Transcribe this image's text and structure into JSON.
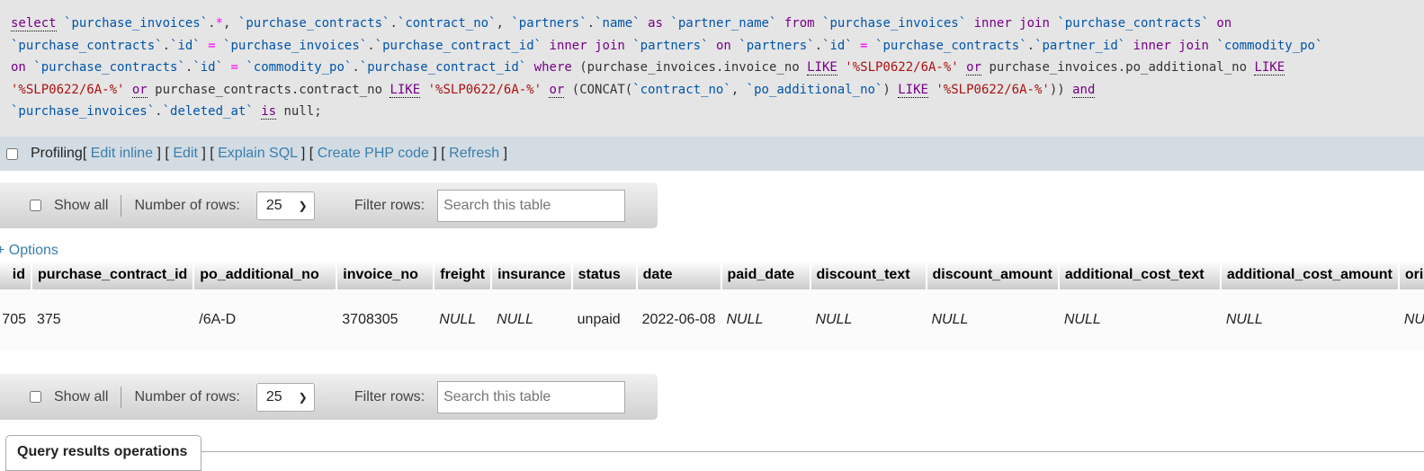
{
  "sql_lines": [
    [
      [
        "kwu",
        "select"
      ],
      [
        "pl",
        " "
      ],
      [
        "id",
        "`purchase_invoices`"
      ],
      [
        "pl",
        "."
      ],
      [
        "op",
        "*"
      ],
      [
        "pl",
        ", "
      ],
      [
        "id",
        "`purchase_contracts`"
      ],
      [
        "pl",
        "."
      ],
      [
        "id",
        "`contract_no`"
      ],
      [
        "pl",
        ", "
      ],
      [
        "id",
        "`partners`"
      ],
      [
        "pl",
        "."
      ],
      [
        "id",
        "`name`"
      ],
      [
        "pl",
        " "
      ],
      [
        "kw",
        "as"
      ],
      [
        "pl",
        " "
      ],
      [
        "id",
        "`partner_name`"
      ],
      [
        "pl",
        " "
      ],
      [
        "kw",
        "from"
      ],
      [
        "pl",
        " "
      ],
      [
        "id",
        "`purchase_invoices`"
      ],
      [
        "pl",
        " "
      ],
      [
        "kw",
        "inner join"
      ],
      [
        "pl",
        " "
      ],
      [
        "id",
        "`purchase_contracts`"
      ],
      [
        "pl",
        " "
      ],
      [
        "kw",
        "on"
      ]
    ],
    [
      [
        "id",
        "`purchase_contracts`"
      ],
      [
        "pl",
        "."
      ],
      [
        "id",
        "`id`"
      ],
      [
        "pl",
        " "
      ],
      [
        "op",
        "="
      ],
      [
        "pl",
        " "
      ],
      [
        "id",
        "`purchase_invoices`"
      ],
      [
        "pl",
        "."
      ],
      [
        "id",
        "`purchase_contract_id`"
      ],
      [
        "pl",
        " "
      ],
      [
        "kw",
        "inner join"
      ],
      [
        "pl",
        " "
      ],
      [
        "id",
        "`partners`"
      ],
      [
        "pl",
        " "
      ],
      [
        "kw",
        "on"
      ],
      [
        "pl",
        " "
      ],
      [
        "id",
        "`partners`"
      ],
      [
        "pl",
        "."
      ],
      [
        "id",
        "`id`"
      ],
      [
        "pl",
        " "
      ],
      [
        "op",
        "="
      ],
      [
        "pl",
        " "
      ],
      [
        "id",
        "`purchase_contracts`"
      ],
      [
        "pl",
        "."
      ],
      [
        "id",
        "`partner_id`"
      ],
      [
        "pl",
        " "
      ],
      [
        "kw",
        "inner join"
      ],
      [
        "pl",
        " "
      ],
      [
        "id",
        "`commodity_po`"
      ]
    ],
    [
      [
        "kw",
        "on"
      ],
      [
        "pl",
        " "
      ],
      [
        "id",
        "`purchase_contracts`"
      ],
      [
        "pl",
        "."
      ],
      [
        "id",
        "`id`"
      ],
      [
        "pl",
        " "
      ],
      [
        "op",
        "="
      ],
      [
        "pl",
        " "
      ],
      [
        "id",
        "`commodity_po`"
      ],
      [
        "pl",
        "."
      ],
      [
        "id",
        "`purchase_contract_id`"
      ],
      [
        "pl",
        " "
      ],
      [
        "kw",
        "where"
      ],
      [
        "pl",
        " (purchase_invoices.invoice_no "
      ],
      [
        "kwu",
        "LIKE"
      ],
      [
        "pl",
        " "
      ],
      [
        "str",
        "'%SLP0622/6A-%'"
      ],
      [
        "pl",
        " "
      ],
      [
        "kwu",
        "or"
      ],
      [
        "pl",
        " purchase_invoices.po_additional_no "
      ],
      [
        "kwu",
        "LIKE"
      ]
    ],
    [
      [
        "str",
        "'%SLP0622/6A-%'"
      ],
      [
        "pl",
        " "
      ],
      [
        "kwu",
        "or"
      ],
      [
        "pl",
        " purchase_contracts.contract_no "
      ],
      [
        "kwu",
        "LIKE"
      ],
      [
        "pl",
        " "
      ],
      [
        "str",
        "'%SLP0622/6A-%'"
      ],
      [
        "pl",
        " "
      ],
      [
        "kwu",
        "or"
      ],
      [
        "pl",
        " (CONCAT("
      ],
      [
        "id",
        "`contract_no`"
      ],
      [
        "pl",
        ", "
      ],
      [
        "id",
        "`po_additional_no`"
      ],
      [
        "pl",
        ") "
      ],
      [
        "kwu",
        "LIKE"
      ],
      [
        "pl",
        " "
      ],
      [
        "str",
        "'%SLP0622/6A-%'"
      ],
      [
        "pl",
        "))"
      ],
      [
        "pl",
        " "
      ],
      [
        "kwu",
        "and"
      ]
    ],
    [
      [
        "id",
        "`purchase_invoices`"
      ],
      [
        "pl",
        "."
      ],
      [
        "id",
        "`deleted_at`"
      ],
      [
        "pl",
        " "
      ],
      [
        "kwu",
        "is"
      ],
      [
        "pl",
        " null;"
      ]
    ]
  ],
  "profiling": {
    "label": "Profiling",
    "links": [
      "Edit inline",
      "Edit",
      "Explain SQL",
      "Create PHP code",
      "Refresh"
    ]
  },
  "nav": {
    "show_all": "Show all",
    "rows_label": "Number of rows:",
    "rows_value": "25",
    "filter_label": "Filter rows:",
    "filter_placeholder": "Search this table"
  },
  "options_label": "+ Options",
  "table": {
    "columns": [
      "id",
      "purchase_contract_id",
      "po_additional_no",
      "invoice_no",
      "freight",
      "insurance",
      "status",
      "date",
      "paid_date",
      "discount_text",
      "discount_amount",
      "additional_cost_text",
      "additional_cost_amount",
      "ori"
    ],
    "rows": [
      [
        "705",
        "375",
        "/6A-D",
        "3708305",
        "NULL",
        "NULL",
        "unpaid",
        "2022-06-08",
        "NULL",
        "NULL",
        "NULL",
        "NULL",
        "NULL",
        "NU"
      ]
    ]
  },
  "query_results_ops": "Query results operations"
}
